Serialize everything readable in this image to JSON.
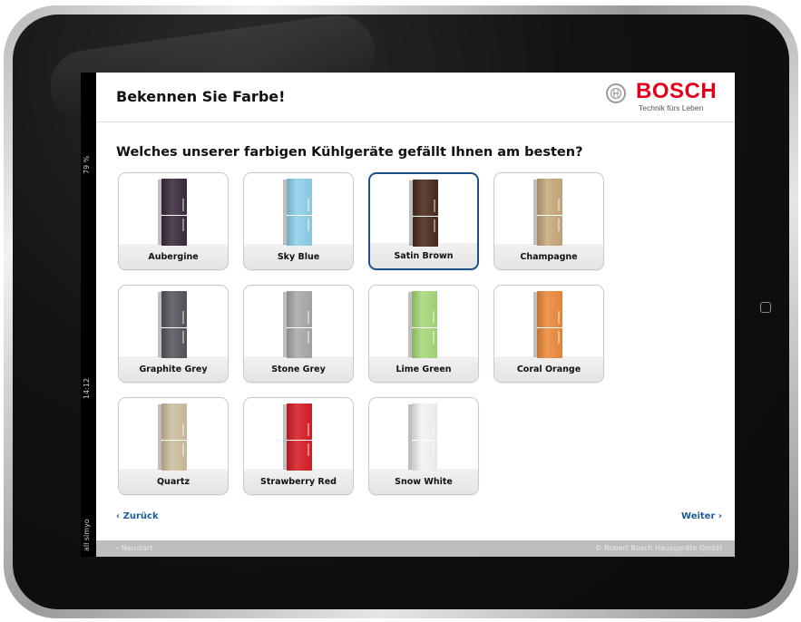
{
  "status_bar": {
    "battery": "79 %",
    "time": "14:12",
    "carrier": "all simyo"
  },
  "header": {
    "title": "Bekennen Sie Farbe!",
    "brand_name": "BOSCH",
    "brand_tagline": "Technik fürs Leben"
  },
  "question": "Welches unserer farbigen Kühlgeräte gefällt Ihnen am besten?",
  "options": [
    {
      "label": "Aubergine",
      "color": "#3a2b3c",
      "selected": false
    },
    {
      "label": "Sky Blue",
      "color": "#8fd0ea",
      "selected": false
    },
    {
      "label": "Satin Brown",
      "color": "#4a2a1c",
      "selected": true
    },
    {
      "label": "Champagne",
      "color": "#c7a97c",
      "selected": false
    },
    {
      "label": "Graphite Grey",
      "color": "#55575c",
      "selected": false
    },
    {
      "label": "Stone Grey",
      "color": "#a9a9a9",
      "selected": false
    },
    {
      "label": "Lime Green",
      "color": "#a6d97a",
      "selected": false
    },
    {
      "label": "Coral Orange",
      "color": "#ec8a3c",
      "selected": false
    },
    {
      "label": "Quartz",
      "color": "#cdbf9f",
      "selected": false
    },
    {
      "label": "Strawberry Red",
      "color": "#d81d26",
      "selected": false
    },
    {
      "label": "Snow White",
      "color": "#f4f4f4",
      "selected": false
    }
  ],
  "nav": {
    "back_label": "‹ Zurück",
    "next_label": "Weiter ›"
  },
  "footer": {
    "restart_label": "‹ Neustart",
    "copyright": "© Robert Bosch Hausgeräte GmbH"
  },
  "colors": {
    "accent": "#1c5c9e",
    "brand_red": "#e2001a",
    "selected_border": "#1c4f8c"
  }
}
